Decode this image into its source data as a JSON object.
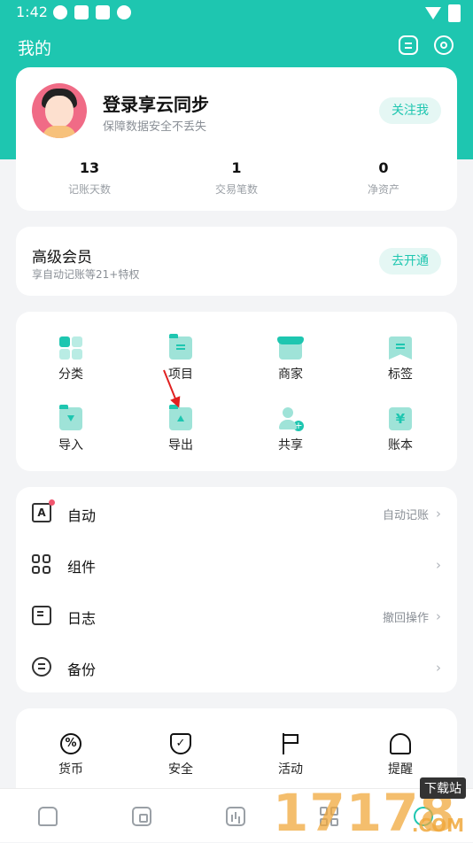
{
  "status": {
    "time": "1:42"
  },
  "header": {
    "title": "我的"
  },
  "profile": {
    "name": "登录享云同步",
    "subtitle": "保障数据安全不丢失",
    "follow_label": "关注我",
    "stats": [
      {
        "value": "13",
        "label": "记账天数"
      },
      {
        "value": "1",
        "label": "交易笔数"
      },
      {
        "value": "0",
        "label": "净资产"
      }
    ]
  },
  "vip": {
    "title": "高级会员",
    "subtitle": "享自动记账等21+特权",
    "button": "去开通"
  },
  "grid": {
    "items": [
      {
        "label": "分类",
        "icon": "category-icon"
      },
      {
        "label": "项目",
        "icon": "project-folder-icon"
      },
      {
        "label": "商家",
        "icon": "shop-icon"
      },
      {
        "label": "标签",
        "icon": "tag-icon"
      },
      {
        "label": "导入",
        "icon": "import-icon"
      },
      {
        "label": "导出",
        "icon": "export-icon"
      },
      {
        "label": "共享",
        "icon": "share-user-icon"
      },
      {
        "label": "账本",
        "icon": "ledger-book-icon"
      }
    ],
    "ledger_icon_glyph": "¥",
    "share_plus_glyph": "+"
  },
  "list": {
    "items": [
      {
        "label": "自动",
        "hint": "自动记账",
        "icon": "auto-a-icon",
        "glyph": "A"
      },
      {
        "label": "组件",
        "hint": "",
        "icon": "widget-grid-icon"
      },
      {
        "label": "日志",
        "hint": "撤回操作",
        "icon": "log-icon"
      },
      {
        "label": "备份",
        "hint": "",
        "icon": "backup-icon"
      }
    ],
    "chevron": "›"
  },
  "tools": {
    "items": [
      {
        "label": "货币",
        "icon": "currency-percent-icon",
        "glyph": "%"
      },
      {
        "label": "安全",
        "icon": "shield-check-icon",
        "glyph": "✓"
      },
      {
        "label": "活动",
        "icon": "flag-icon"
      },
      {
        "label": "提醒",
        "icon": "bell-icon"
      }
    ]
  },
  "tabbar": {
    "items": [
      "home-icon",
      "wallet-icon",
      "stats-icon",
      "apps-icon",
      "profile-icon"
    ]
  },
  "watermark": {
    "digits": "17178",
    "tag": "下载站",
    "suffix": ".COM"
  },
  "colors": {
    "accent": "#1ec6b0",
    "arrow": "#e02020"
  }
}
